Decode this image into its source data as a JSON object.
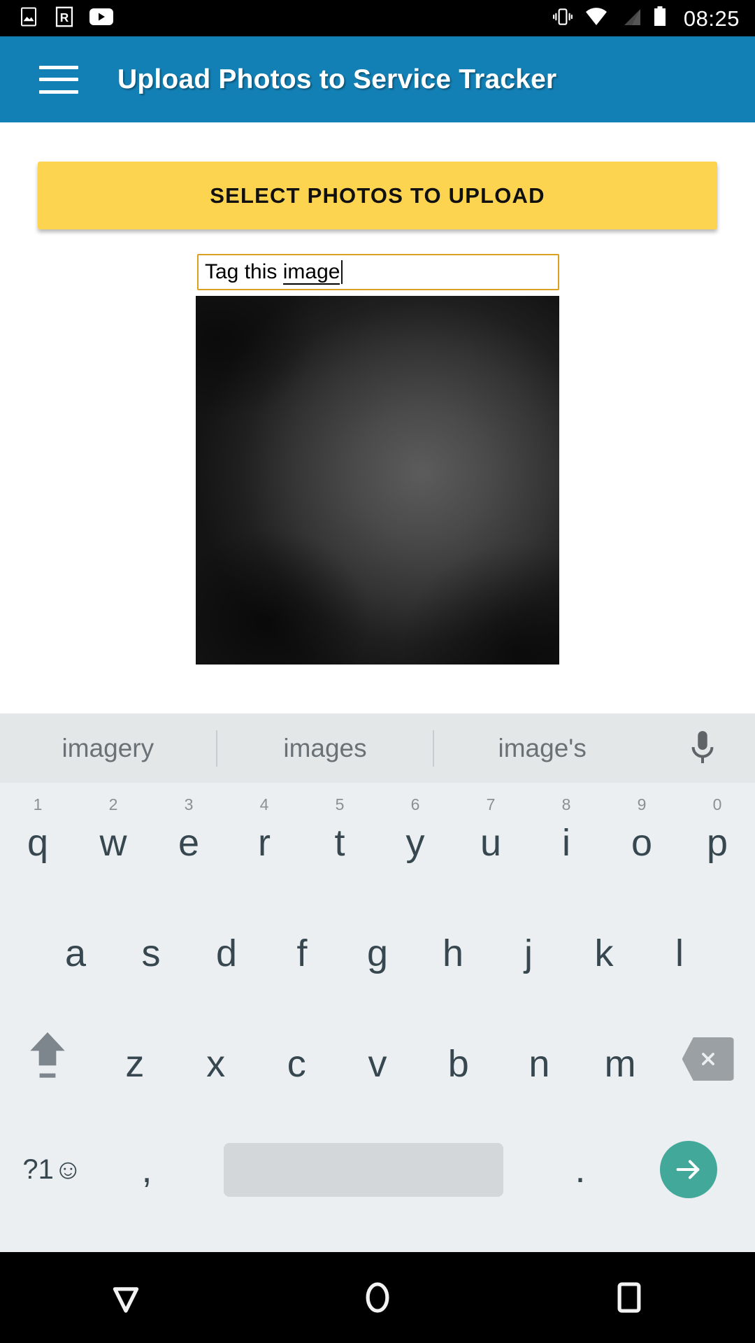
{
  "status_bar": {
    "time": "08:25",
    "left_icons": [
      "gallery-icon",
      "r-app-icon",
      "youtube-icon"
    ],
    "right_icons": [
      "vibrate-icon",
      "wifi-icon",
      "signal-icon",
      "battery-icon"
    ]
  },
  "app_bar": {
    "menu_icon": "hamburger-menu-icon",
    "title": "Upload Photos to Service Tracker",
    "background_color": "#1380b5"
  },
  "content": {
    "upload_button_label": "SELECT PHOTOS TO UPLOAD",
    "upload_button_color": "#fcd450",
    "tag_field": {
      "value_prefix": "Tag this ",
      "value_composing": "image",
      "placeholder": "Tag this image",
      "border_color": "#d9a022"
    },
    "photo_preview": {
      "alt": "dark-photo-thumbnail"
    }
  },
  "keyboard": {
    "suggestions": [
      "imagery",
      "images",
      "image's"
    ],
    "mic_icon": "microphone-icon",
    "row1": [
      {
        "num": "1",
        "letter": "q"
      },
      {
        "num": "2",
        "letter": "w"
      },
      {
        "num": "3",
        "letter": "e"
      },
      {
        "num": "4",
        "letter": "r"
      },
      {
        "num": "5",
        "letter": "t"
      },
      {
        "num": "6",
        "letter": "y"
      },
      {
        "num": "7",
        "letter": "u"
      },
      {
        "num": "8",
        "letter": "i"
      },
      {
        "num": "9",
        "letter": "o"
      },
      {
        "num": "0",
        "letter": "p"
      }
    ],
    "row2": [
      "a",
      "s",
      "d",
      "f",
      "g",
      "h",
      "j",
      "k",
      "l"
    ],
    "row3": [
      "z",
      "x",
      "c",
      "v",
      "b",
      "n",
      "m"
    ],
    "shift_icon": "shift-arrow-icon",
    "backspace_icon": "backspace-icon",
    "symbols_key_label": "?1☺",
    "comma_key_label": ",",
    "period_key_label": ".",
    "space_key_label": "",
    "enter_icon": "arrow-right-icon",
    "enter_color": "#42a89a",
    "background_color": "#eceff1",
    "suggestion_bar_color": "#e4e7e8"
  },
  "nav_bar": {
    "back_icon": "hide-keyboard-triangle-icon",
    "home_icon": "home-circle-icon",
    "recents_icon": "recents-square-icon"
  }
}
